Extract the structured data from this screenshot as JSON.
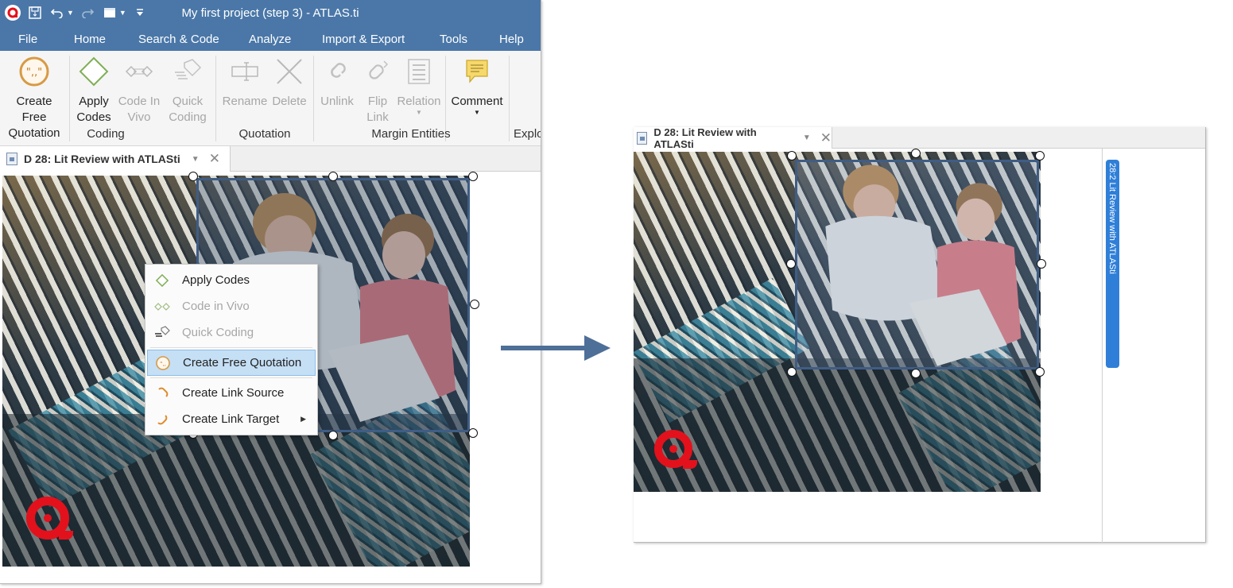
{
  "colors": {
    "title_bar": "#4a77a8",
    "accent_blue": "#2f7fd8",
    "quote_border": "#3f5d85",
    "logo_red": "#e3111c",
    "hover": "#c5dff5"
  },
  "left_window": {
    "title": "My first project (step 3) - ATLAS.ti",
    "qat_icons": [
      "atlas-logo-icon",
      "save-icon",
      "undo-icon",
      "redo-icon",
      "window-icon",
      "customize-icon"
    ],
    "menu": [
      "File",
      "Home",
      "Search & Code",
      "Analyze",
      "Import & Export",
      "Tools",
      "Help"
    ],
    "ribbon": {
      "coding": {
        "label": "Coding",
        "create_free_quotation": {
          "line1": "Create Free",
          "line2": "Quotation"
        },
        "apply_codes": {
          "line1": "Apply",
          "line2": "Codes"
        },
        "code_in_vivo": {
          "line1": "Code In",
          "line2": "Vivo"
        },
        "quick_coding": {
          "line1": "Quick",
          "line2": "Coding"
        }
      },
      "quotation": {
        "label": "Quotation",
        "rename": "Rename",
        "delete": "Delete"
      },
      "margin_entities": {
        "label": "Margin Entities",
        "unlink": "Unlink",
        "flip_link": {
          "line1": "Flip",
          "line2": "Link"
        },
        "relation": "Relation",
        "comment": "Comment"
      },
      "explore": {
        "label": "Explo"
      }
    },
    "doc_tab": {
      "label": "D 28: Lit Review with ATLASti"
    },
    "context_menu": [
      {
        "label": "Apply Codes",
        "icon": "diamond-icon",
        "enabled": true,
        "highlighted": false
      },
      {
        "label": "Code in Vivo",
        "icon": "in-vivo-icon",
        "enabled": false,
        "highlighted": false
      },
      {
        "label": "Quick Coding",
        "icon": "quick-coding-icon",
        "enabled": false,
        "highlighted": false
      },
      {
        "label": "Create Free Quotation",
        "icon": "quotation-icon",
        "enabled": true,
        "highlighted": true
      },
      {
        "label": "Create Link Source",
        "icon": "link-icon",
        "enabled": true,
        "highlighted": false
      },
      {
        "label": "Create Link Target",
        "icon": "link-icon",
        "enabled": true,
        "highlighted": false,
        "submenu": true
      }
    ]
  },
  "right_window": {
    "doc_tab": {
      "label": "D 28: Lit Review with ATLASti"
    },
    "margin_quotation_label": "28:2 Lit Review with ATLASti"
  }
}
